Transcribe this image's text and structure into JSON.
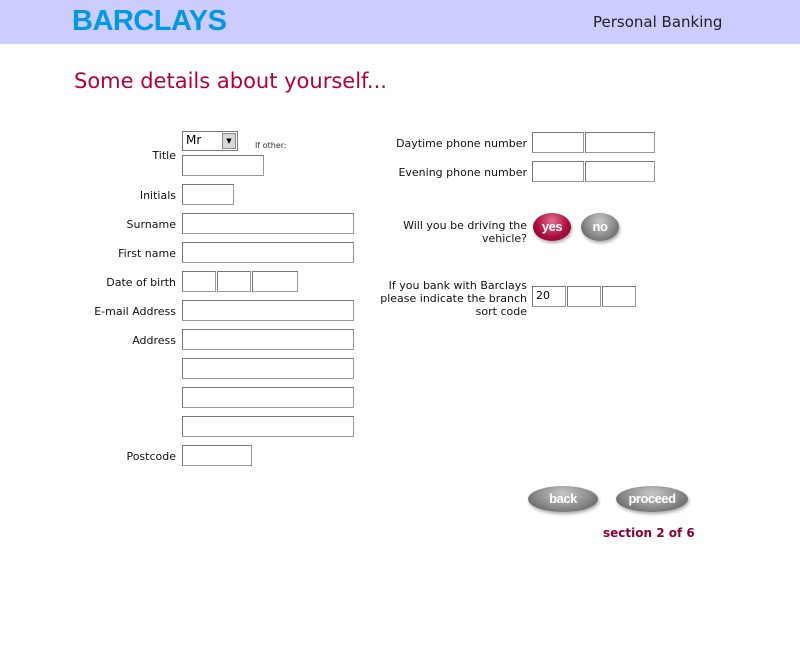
{
  "header": {
    "logo_text": "BARCLAYS",
    "section_name": "Personal Banking",
    "background": "#ccccff",
    "logo_color": "#0099e6"
  },
  "page": {
    "heading": "Some details about yourself...",
    "heading_color": "#b3003c"
  },
  "form_left": {
    "title_label": "Title",
    "title_selected": "Mr",
    "if_other_label": "If other:",
    "initials_label": "Initials",
    "surname_label": "Surname",
    "first_name_label": "First name",
    "dob_label": "Date of birth",
    "email_label": "E-mail Address",
    "address_label": "Address",
    "postcode_label": "Postcode"
  },
  "form_right": {
    "daytime_phone_label": "Daytime phone number",
    "evening_phone_label": "Evening phone number",
    "driving_label_line1": "Will you be driving the",
    "driving_label_line2": "vehicle?",
    "yes_label": "yes",
    "no_label": "no",
    "sort_label_line1": "If you bank with Barclays",
    "sort_label_line2": "please indicate the branch",
    "sort_label_line3": "sort code",
    "sort_code_part1": "20"
  },
  "nav": {
    "back_label": "back",
    "proceed_label": "proceed",
    "progress_text": "section 2 of 6"
  }
}
